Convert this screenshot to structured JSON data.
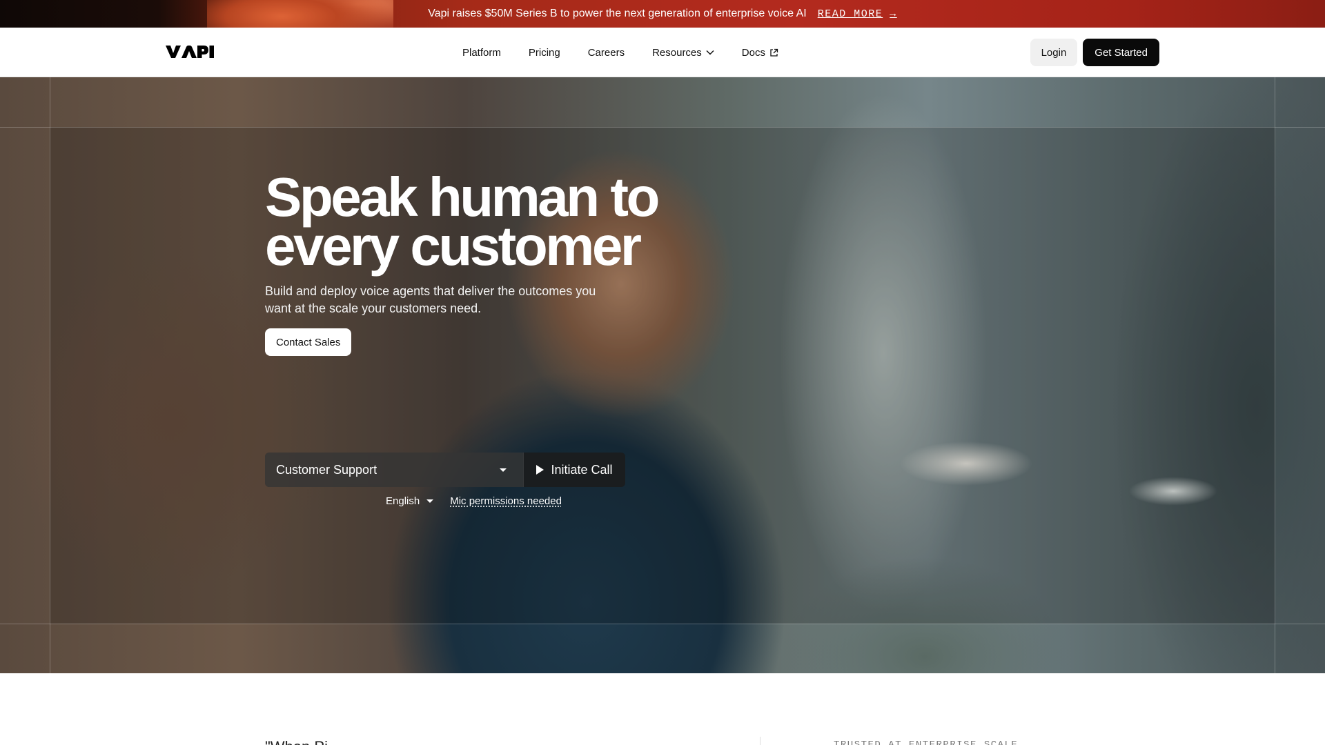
{
  "announcement": {
    "text": "Vapi raises $50M Series B to power the next generation of enterprise voice AI",
    "link_label": "READ MORE",
    "arrow": "→"
  },
  "nav": {
    "logo_text": "VAPI",
    "links": [
      {
        "label": "Platform"
      },
      {
        "label": "Pricing"
      },
      {
        "label": "Careers"
      },
      {
        "label": "Resources",
        "icon": "chevron-down-icon"
      },
      {
        "label": "Docs",
        "icon": "external-link-icon"
      }
    ],
    "login_label": "Login",
    "get_started_label": "Get Started"
  },
  "hero": {
    "title_line1": "Speak human to",
    "title_line2": "every customer",
    "subtitle": "Build and deploy voice agents that deliver the outcomes you want at the scale your customers need.",
    "contact_label": "Contact Sales",
    "agent_select_value": "Customer Support",
    "initiate_label": "Initiate Call",
    "language_value": "English",
    "mic_status": "Mic permissions needed"
  },
  "below": {
    "quote_fragment": "\"When Pi...",
    "trusted_label": "TRUSTED AT ENTERPRISE SCALE"
  },
  "colors": {
    "announcement_bg": "#b32a1e",
    "primary_button": "#0a0a0a",
    "login_button": "#f0f0f0"
  }
}
